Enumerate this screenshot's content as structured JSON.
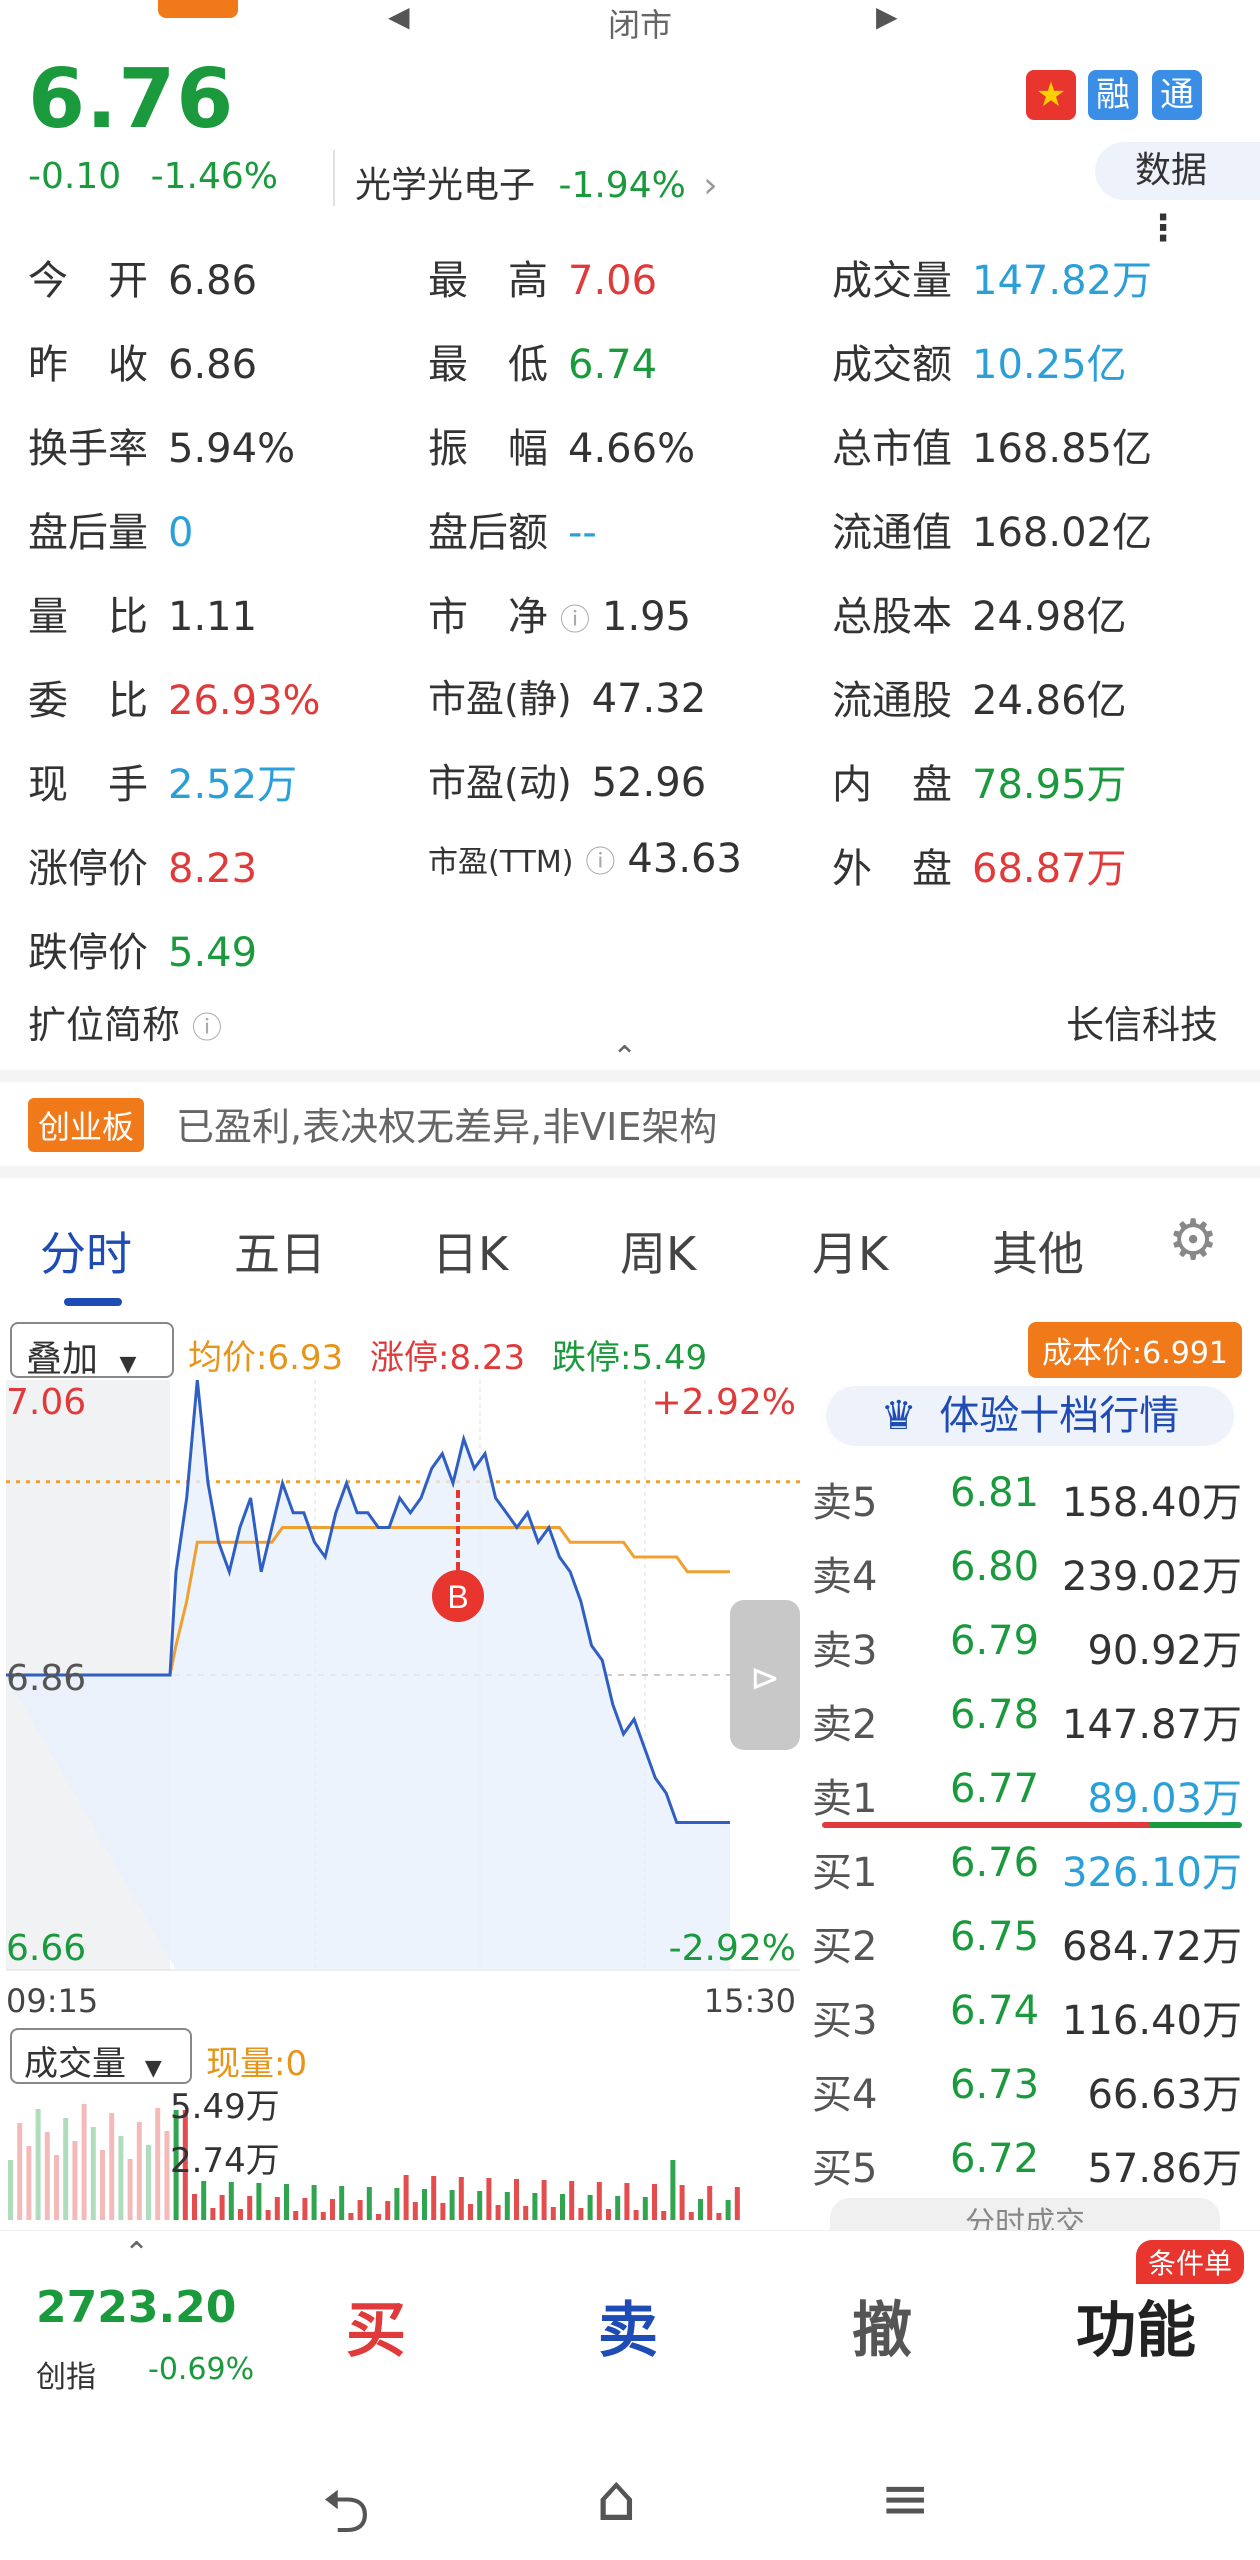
{
  "status": {
    "market_state": "闭市"
  },
  "stock": {
    "price": "6.76",
    "change": "-0.10",
    "change_pct": "-1.46%",
    "sector_name": "光学光电子",
    "sector_pct": "-1.94%",
    "badges": [
      "融",
      "通"
    ],
    "data_label": "数据"
  },
  "quote": {
    "open_l": "今　开",
    "open_v": "6.86",
    "high_l": "最　高",
    "high_v": "7.06",
    "volume_l": "成交量",
    "volume_v": "147.82万",
    "prev_l": "昨　收",
    "prev_v": "6.86",
    "low_l": "最　低",
    "low_v": "6.74",
    "amount_l": "成交额",
    "amount_v": "10.25亿",
    "turnover_l": "换手率",
    "turnover_v": "5.94%",
    "amp_l": "振　幅",
    "amp_v": "4.66%",
    "mktcap_l": "总市值",
    "mktcap_v": "168.85亿",
    "ahvol_l": "盘后量",
    "ahvol_v": "0",
    "ahamt_l": "盘后额",
    "ahamt_v": "--",
    "float_l": "流通值",
    "float_v": "168.02亿",
    "volratio_l": "量　比",
    "volratio_v": "1.11",
    "pb_l": "市　净",
    "pb_v": "1.95",
    "shares_l": "总股本",
    "shares_v": "24.98亿",
    "commit_l": "委　比",
    "commit_v": "26.93%",
    "pe_static_l": "市盈(静)",
    "pe_static_v": "47.32",
    "float_shares_l": "流通股",
    "float_shares_v": "24.86亿",
    "hand_l": "现　手",
    "hand_v": "2.52万",
    "pe_dyn_l": "市盈(动)",
    "pe_dyn_v": "52.96",
    "inner_l": "内　盘",
    "inner_v": "78.95万",
    "limitup_l": "涨停价",
    "limitup_v": "8.23",
    "pe_ttm_l": "市盈(TTM)",
    "pe_ttm_v": "43.63",
    "outer_l": "外　盘",
    "outer_v": "68.87万",
    "limitdown_l": "跌停价",
    "limitdown_v": "5.49",
    "short_name_l": "扩位简称",
    "short_name_v": "长信科技"
  },
  "board": {
    "tag": "创业板",
    "desc": "已盈利,表决权无差异,非VIE架构"
  },
  "tabs": [
    "分时",
    "五日",
    "日K",
    "周K",
    "月K",
    "其他"
  ],
  "overlay": {
    "select": "叠加",
    "avg": "均价:6.93",
    "limit_up": "涨停:8.23",
    "limit_down": "跌停:5.49",
    "cost": "成本价:6.991"
  },
  "chart_data": {
    "type": "line",
    "ylim": [
      6.66,
      7.06
    ],
    "y_ticks": [
      "7.06",
      "6.86",
      "6.66"
    ],
    "pct_ticks": [
      "+2.92%",
      "-2.92%"
    ],
    "x_ticks": [
      "09:15",
      "15:30"
    ],
    "prev_close": 6.86,
    "marker": "B",
    "price": [
      6.86,
      6.86,
      6.86,
      6.86,
      6.86,
      6.86,
      6.86,
      6.86,
      6.86,
      6.86,
      6.86,
      6.86,
      6.86,
      6.86,
      6.86,
      6.86,
      6.93,
      6.98,
      7.06,
      6.99,
      6.95,
      6.93,
      6.96,
      6.98,
      6.93,
      6.96,
      6.99,
      6.97,
      6.97,
      6.95,
      6.94,
      6.97,
      6.99,
      6.97,
      6.97,
      6.96,
      6.96,
      6.98,
      6.97,
      6.98,
      7.0,
      7.01,
      6.99,
      7.02,
      7.0,
      7.01,
      6.98,
      6.97,
      6.96,
      6.97,
      6.95,
      6.96,
      6.94,
      6.93,
      6.91,
      6.88,
      6.87,
      6.84,
      6.82,
      6.83,
      6.81,
      6.79,
      6.78,
      6.76,
      6.76,
      6.76,
      6.76,
      6.76,
      6.76
    ],
    "avg": [
      6.86,
      6.86,
      6.86,
      6.86,
      6.86,
      6.86,
      6.86,
      6.86,
      6.86,
      6.86,
      6.86,
      6.86,
      6.86,
      6.86,
      6.86,
      6.86,
      6.88,
      6.91,
      6.95,
      6.95,
      6.95,
      6.95,
      6.95,
      6.95,
      6.95,
      6.95,
      6.96,
      6.96,
      6.96,
      6.96,
      6.96,
      6.96,
      6.96,
      6.96,
      6.96,
      6.96,
      6.96,
      6.96,
      6.96,
      6.96,
      6.96,
      6.96,
      6.96,
      6.96,
      6.96,
      6.96,
      6.96,
      6.96,
      6.96,
      6.96,
      6.96,
      6.96,
      6.96,
      6.95,
      6.95,
      6.95,
      6.95,
      6.95,
      6.95,
      6.94,
      6.94,
      6.94,
      6.94,
      6.94,
      6.93,
      6.93,
      6.93,
      6.93,
      6.93
    ]
  },
  "volume": {
    "select": "成交量",
    "now": "现量:0",
    "ticks": [
      "5.49万",
      "2.74万"
    ]
  },
  "orderbook": {
    "header": "体验十档行情",
    "asks": [
      {
        "label": "卖5",
        "price": "6.81",
        "vol": "158.40万"
      },
      {
        "label": "卖4",
        "price": "6.80",
        "vol": "239.02万"
      },
      {
        "label": "卖3",
        "price": "6.79",
        "vol": "90.92万"
      },
      {
        "label": "卖2",
        "price": "6.78",
        "vol": "147.87万"
      },
      {
        "label": "卖1",
        "price": "6.77",
        "vol": "89.03万"
      }
    ],
    "bids": [
      {
        "label": "买1",
        "price": "6.76",
        "vol": "326.10万"
      },
      {
        "label": "买2",
        "price": "6.75",
        "vol": "684.72万"
      },
      {
        "label": "买3",
        "price": "6.74",
        "vol": "116.40万"
      },
      {
        "label": "买4",
        "price": "6.73",
        "vol": "66.63万"
      },
      {
        "label": "买5",
        "price": "6.72",
        "vol": "57.86万"
      }
    ],
    "footer": "分时成交"
  },
  "trade": {
    "index_value": "2723.20",
    "index_name": "创指",
    "index_change": "-0.69%",
    "buy": "买",
    "sell": "卖",
    "cancel": "撤",
    "func": "功能",
    "cond": "条件单"
  },
  "colors": {
    "up": "#e03a3a",
    "down": "#1a9a3c",
    "accent": "#1f4bb5",
    "orange": "#f07a1a",
    "line": "#2f5fc4",
    "avg": "#f0a030"
  }
}
